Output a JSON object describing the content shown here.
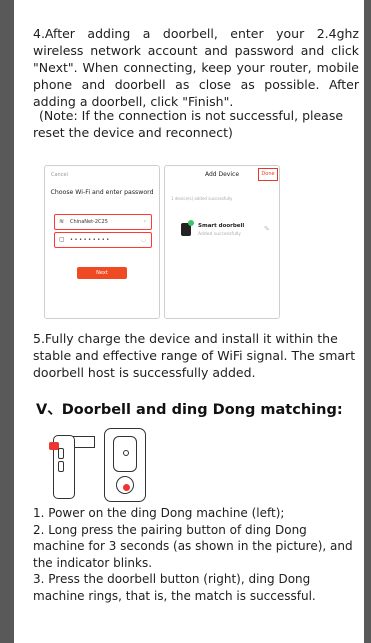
{
  "step4": {
    "text": "4.After adding a doorbell, enter your 2.4ghz wireless network account and password and click \"Next\". When connecting, keep your router, mobile phone and doorbell as close as possible. After adding a doorbell, click \"Finish\".",
    "note": "(Note: If the connection is not successful, please reset the device and reconnect)"
  },
  "wifi_screen": {
    "cancel": "Cancel",
    "title": "Choose Wi-Fi and enter password",
    "network": "ChinaNet-2C25",
    "password_mask": "• • • • • • • • •",
    "next": "Next"
  },
  "add_screen": {
    "title": "Add Device",
    "done": "Done",
    "subtitle": "1 device(s) added successfully",
    "device_name": "Smart doorbell",
    "device_state": "Added successfully"
  },
  "step5": "5.Fully charge the device and install it within the stable and effective range of WiFi signal. The smart doorbell host is successfully added.",
  "section_heading": "V、Doorbell and ding Dong matching:",
  "steps": [
    "1. Power on the ding Dong machine (left);",
    "2. Long press the pairing button of ding Dong machine for 3 seconds (as shown in the picture), and the indicator blinks.",
    "3. Press the doorbell button (right), ding Dong machine rings, that is, the match is successful."
  ]
}
